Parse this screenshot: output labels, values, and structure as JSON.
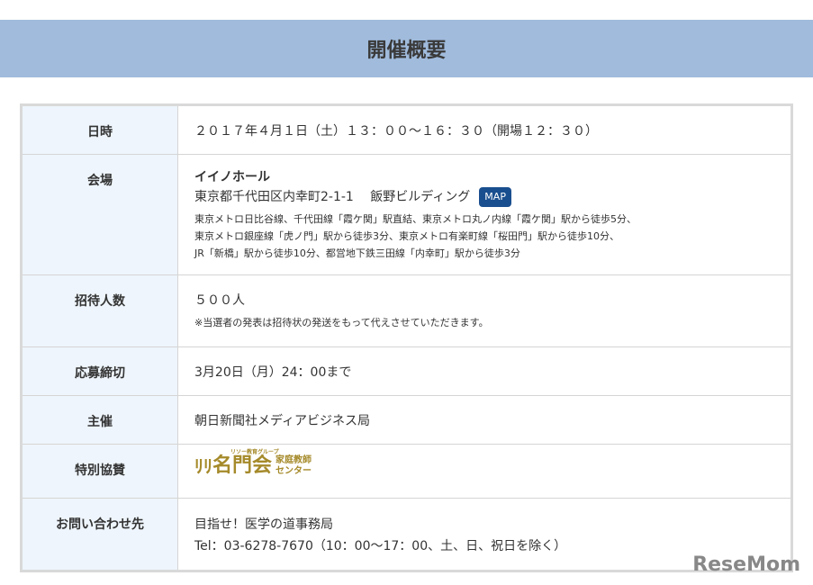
{
  "title": "開催概要",
  "rows": {
    "datetime": {
      "label": "日時",
      "value": "２０１７年４月１日（土）１３：００～１６：３０（開場１２：３０）"
    },
    "venue": {
      "label": "会場",
      "name": "イイノホール",
      "address": "東京都千代田区内幸町2-1-1　 飯野ビルディング",
      "map": "MAP",
      "access": [
        "東京メトロ日比谷線、千代田線「霞ケ関」駅直結、東京メトロ丸ノ内線「霞ケ関」駅から徒歩5分、",
        "東京メトロ銀座線「虎ノ門」駅から徒歩3分、東京メトロ有楽町線「桜田門」駅から徒歩10分、",
        "JR「新橋」駅から徒歩10分、都営地下鉄三田線「内幸町」駅から徒歩3分"
      ]
    },
    "invitees": {
      "label": "招待人数",
      "value": "５００人",
      "note": "※当選者の発表は招待状の発送をもって代えさせていただきます。"
    },
    "deadline": {
      "label": "応募締切",
      "value": "3月20日（月）24：00まで"
    },
    "organizer": {
      "label": "主催",
      "value": "朝日新聞社メディアビジネス局"
    },
    "sponsor": {
      "label": "特別協賛",
      "logo_main": "名門会",
      "logo_sub1": "家庭教師",
      "logo_sub2": "センター",
      "logo_top": "リソー教育グループ"
    },
    "contact": {
      "label": "お問い合わせ先",
      "name": "目指せ！医学の道事務局",
      "tel": "Tel：03-6278-7670（10：00～17：00、土、日、祝日を除く）"
    }
  },
  "watermark": "ReseMom"
}
